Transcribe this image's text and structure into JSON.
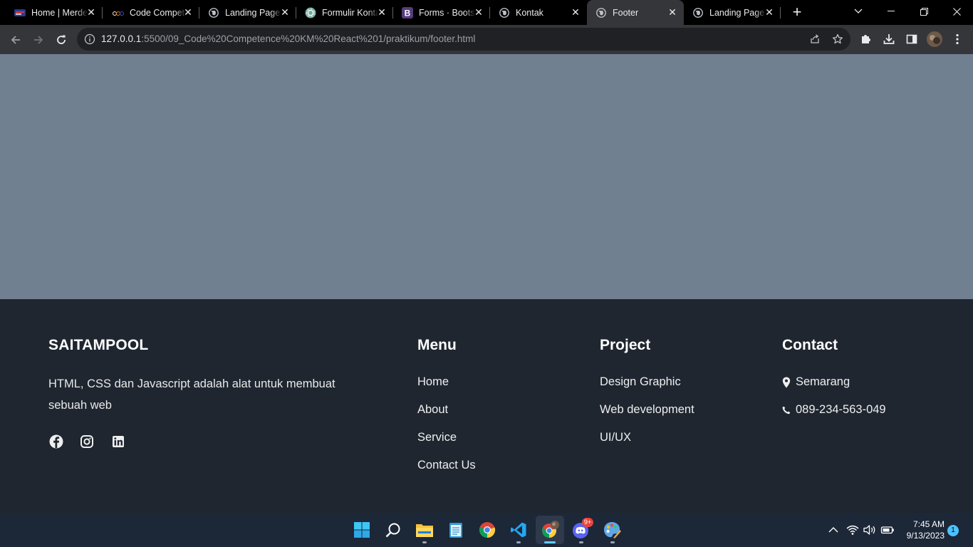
{
  "browser": {
    "tabs": [
      {
        "title": "Home | Merdeka",
        "icon": "merdeka-favicon-icon"
      },
      {
        "title": "Code Competence",
        "icon": "alterra-favicon-icon"
      },
      {
        "title": "Landing Page",
        "icon": "globe-icon"
      },
      {
        "title": "Formulir Kontak",
        "icon": "chatgpt-favicon-icon"
      },
      {
        "title": "Forms · Bootstrap",
        "icon": "bootstrap-favicon-icon"
      },
      {
        "title": "Kontak",
        "icon": "globe-icon"
      },
      {
        "title": "Footer",
        "icon": "globe-icon"
      },
      {
        "title": "Landing Page",
        "icon": "globe-icon"
      }
    ],
    "active_tab_index": 6,
    "url_host": "127.0.0.1",
    "url_rest": ":5500/09_Code%20Competence%20KM%20React%201/praktikum/footer.html"
  },
  "page": {
    "hero_color": "#708090",
    "footer_color": "#1f2630",
    "brand": "SAITAMPOOL",
    "about": "HTML, CSS dan Javascript adalah alat untuk membuat sebuah web",
    "social": [
      "facebook-icon",
      "instagram-icon",
      "linkedin-icon"
    ],
    "menu": {
      "heading": "Menu",
      "links": [
        "Home",
        "About",
        "Service",
        "Contact Us"
      ]
    },
    "project": {
      "heading": "Project",
      "links": [
        "Design Graphic",
        "Web development",
        "UI/UX"
      ]
    },
    "contact": {
      "heading": "Contact",
      "location": "Semarang",
      "phone": "089-234-563-049"
    }
  },
  "taskbar": {
    "time": "7:45 AM",
    "date": "9/13/2023",
    "notification_count": "1",
    "discord_badge": "9+"
  }
}
